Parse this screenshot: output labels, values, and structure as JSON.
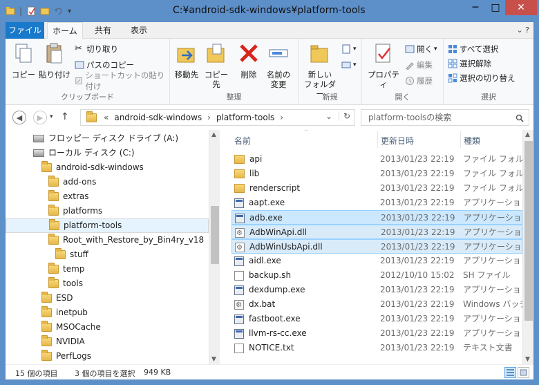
{
  "window": {
    "title": "C:¥android-sdk-windows¥platform-tools",
    "minimize": "─",
    "maximize": "□",
    "close": "✕"
  },
  "tabs": {
    "file": "ファイル",
    "home": "ホーム",
    "share": "共有",
    "view": "表示",
    "help": "⌄  ?"
  },
  "ribbon": {
    "clipboard": {
      "label": "クリップボード",
      "copy": "コピー",
      "paste": "貼り付け",
      "cut": "切り取り",
      "copy_path": "パスのコピー",
      "paste_shortcut": "ショートカットの貼り付け"
    },
    "organize": {
      "label": "整理",
      "move_to": "移動先",
      "copy_to": "コピー先",
      "delete": "削除",
      "rename_l1": "名前の",
      "rename_l2": "変更"
    },
    "new": {
      "label": "新規",
      "new_folder_l1": "新しい",
      "new_folder_l2": "フォルダー"
    },
    "open": {
      "label": "開く",
      "properties": "プロパティ",
      "open": "開く",
      "edit": "編集",
      "history": "履歴"
    },
    "select": {
      "label": "選択",
      "select_all": "すべて選択",
      "select_none": "選択解除",
      "invert": "選択の切り替え"
    }
  },
  "address": {
    "back": "◀",
    "forward": "▶",
    "up": "↑",
    "crumbs": [
      "«",
      "android-sdk-windows",
      "›",
      "platform-tools",
      "›"
    ],
    "refresh": "↻",
    "search_placeholder": "platform-toolsの検索",
    "dropdown": "⌄"
  },
  "nav_tree": [
    {
      "label": "フロッピー ディスク ドライブ (A:)",
      "type": "drive"
    },
    {
      "label": "ローカル ディスク (C:)",
      "type": "drive"
    },
    {
      "label": "android-sdk-windows",
      "type": "folder"
    },
    {
      "label": "add-ons",
      "type": "folder"
    },
    {
      "label": "extras",
      "type": "folder"
    },
    {
      "label": "platforms",
      "type": "folder"
    },
    {
      "label": "platform-tools",
      "type": "folder",
      "selected": true
    },
    {
      "label": "Root_with_Restore_by_Bin4ry_v18",
      "type": "folder"
    },
    {
      "label": "stuff",
      "type": "folder"
    },
    {
      "label": "temp",
      "type": "folder"
    },
    {
      "label": "tools",
      "type": "folder"
    },
    {
      "label": "ESD",
      "type": "folder"
    },
    {
      "label": "inetpub",
      "type": "folder"
    },
    {
      "label": "MSOCache",
      "type": "folder"
    },
    {
      "label": "NVIDIA",
      "type": "folder"
    },
    {
      "label": "PerfLogs",
      "type": "folder"
    }
  ],
  "columns": {
    "name": "名前",
    "date": "更新日時",
    "type": "種類"
  },
  "files": [
    {
      "name": "api",
      "date": "2013/01/23 22:19",
      "type": "ファイル フォルダー",
      "icon": "folder"
    },
    {
      "name": "lib",
      "date": "2013/01/23 22:19",
      "type": "ファイル フォルダー",
      "icon": "folder"
    },
    {
      "name": "renderscript",
      "date": "2013/01/23 22:19",
      "type": "ファイル フォルダー",
      "icon": "folder"
    },
    {
      "name": "aapt.exe",
      "date": "2013/01/23 22:19",
      "type": "アプリケーション",
      "icon": "exe"
    },
    {
      "name": "adb.exe",
      "date": "2013/01/23 22:19",
      "type": "アプリケーション",
      "icon": "exe",
      "selected": true
    },
    {
      "name": "AdbWinApi.dll",
      "date": "2013/01/23 22:19",
      "type": "アプリケーション拡張",
      "icon": "dll",
      "selected": true
    },
    {
      "name": "AdbWinUsbApi.dll",
      "date": "2013/01/23 22:19",
      "type": "アプリケーション拡張",
      "icon": "dll",
      "selected": true
    },
    {
      "name": "aidl.exe",
      "date": "2013/01/23 22:19",
      "type": "アプリケーション",
      "icon": "exe"
    },
    {
      "name": "backup.sh",
      "date": "2012/10/10 15:02",
      "type": "SH ファイル",
      "icon": "txt"
    },
    {
      "name": "dexdump.exe",
      "date": "2013/01/23 22:19",
      "type": "アプリケーション",
      "icon": "exe"
    },
    {
      "name": "dx.bat",
      "date": "2013/01/23 22:19",
      "type": "Windows バッチ",
      "icon": "bat"
    },
    {
      "name": "fastboot.exe",
      "date": "2013/01/23 22:19",
      "type": "アプリケーション",
      "icon": "exe"
    },
    {
      "name": "llvm-rs-cc.exe",
      "date": "2013/01/23 22:19",
      "type": "アプリケーション",
      "icon": "exe"
    },
    {
      "name": "NOTICE.txt",
      "date": "2013/01/23 22:19",
      "type": "テキスト文書",
      "icon": "txt"
    }
  ],
  "status": {
    "item_count": "15 個の項目",
    "selected": "3 個の項目を選択",
    "size": "949 KB"
  }
}
